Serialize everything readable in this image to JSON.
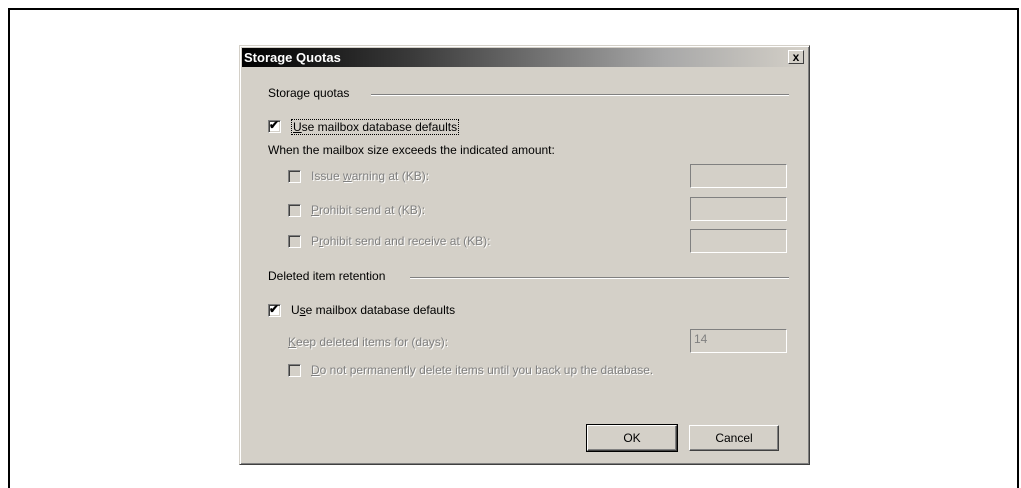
{
  "dialog": {
    "title": "Storage Quotas",
    "close_label": "x"
  },
  "storage": {
    "section_label": "Storage quotas",
    "use_defaults": {
      "prefix": "",
      "accel": "U",
      "suffix": "se mailbox database defaults",
      "checked": true
    },
    "exceeds_label": "When the mailbox size exceeds the indicated amount:",
    "issue_warning": {
      "prefix": "Issue ",
      "accel": "w",
      "suffix": "arning at (KB):",
      "value": "",
      "checked": false
    },
    "prohibit_send": {
      "prefix": "",
      "accel": "P",
      "suffix": "rohibit send at (KB):",
      "value": "",
      "checked": false
    },
    "prohibit_send_receive": {
      "prefix": "P",
      "accel": "r",
      "suffix": "ohibit send and receive at (KB):",
      "value": "",
      "checked": false
    }
  },
  "retention": {
    "section_label": "Deleted item retention",
    "use_defaults": {
      "prefix": "U",
      "accel": "s",
      "suffix": "e mailbox database defaults",
      "checked": true
    },
    "keep_label": {
      "prefix": "",
      "accel": "K",
      "suffix": "eep deleted items for (days):"
    },
    "keep_value": "14",
    "no_delete": {
      "prefix": "",
      "accel": "D",
      "suffix": "o not permanently delete items until you back up the database.",
      "checked": false
    }
  },
  "buttons": {
    "ok": "OK",
    "cancel": "Cancel"
  }
}
